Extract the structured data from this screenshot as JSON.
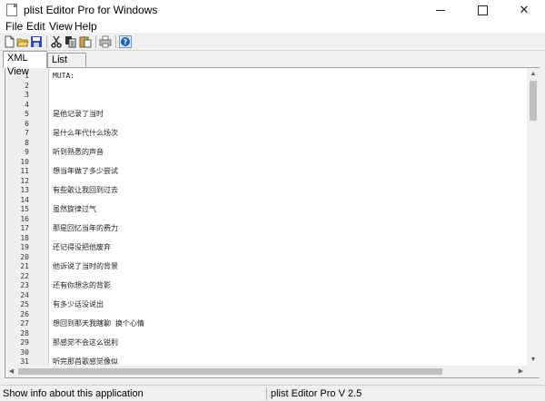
{
  "window": {
    "title": "plist Editor Pro for Windows",
    "minimize_glyph": "",
    "maximize_glyph": "",
    "close_glyph": "✕"
  },
  "menu": [
    "File",
    "Edit",
    "View",
    "Help"
  ],
  "toolbar": {
    "icons": [
      "new-file-icon",
      "open-folder-icon",
      "save-icon",
      "cut-icon",
      "copy-icon",
      "paste-icon",
      "print-icon",
      "help-icon"
    ]
  },
  "tabs": [
    {
      "label": "XML View",
      "active": true
    },
    {
      "label": "List View",
      "active": false
    }
  ],
  "editor": {
    "lines": [
      {
        "num": "1",
        "text": "MUTA:"
      },
      {
        "num": "2",
        "text": ""
      },
      {
        "num": "3",
        "text": ""
      },
      {
        "num": "4",
        "text": ""
      },
      {
        "num": "5",
        "text": "是他记录了当时"
      },
      {
        "num": "6",
        "text": ""
      },
      {
        "num": "7",
        "text": "是什么年代什么场次"
      },
      {
        "num": "8",
        "text": ""
      },
      {
        "num": "9",
        "text": "听到熟悉的声音"
      },
      {
        "num": "10",
        "text": ""
      },
      {
        "num": "11",
        "text": "想当年做了多少尝试"
      },
      {
        "num": "12",
        "text": ""
      },
      {
        "num": "13",
        "text": "有些歌让我回到过去"
      },
      {
        "num": "14",
        "text": ""
      },
      {
        "num": "15",
        "text": "虽然旋律过气"
      },
      {
        "num": "16",
        "text": ""
      },
      {
        "num": "17",
        "text": "那是回忆当年的费力"
      },
      {
        "num": "18",
        "text": ""
      },
      {
        "num": "19",
        "text": "还记得没把他废弃"
      },
      {
        "num": "20",
        "text": ""
      },
      {
        "num": "21",
        "text": "他诉说了当时的背景"
      },
      {
        "num": "22",
        "text": ""
      },
      {
        "num": "23",
        "text": "还有你想念的背影"
      },
      {
        "num": "24",
        "text": ""
      },
      {
        "num": "25",
        "text": "有多少话没说出"
      },
      {
        "num": "26",
        "text": ""
      },
      {
        "num": "27",
        "text": "想回到那天我瞎聊 换个心情"
      },
      {
        "num": "28",
        "text": ""
      },
      {
        "num": "29",
        "text": "那感觉不会这么锐利"
      },
      {
        "num": "30",
        "text": ""
      },
      {
        "num": "31",
        "text": "听完那首歌感觉像似"
      }
    ],
    "scroll_position": 0.0
  },
  "status": {
    "left": "Show info about this application",
    "right": "plist Editor Pro V 2.5"
  },
  "colors": {
    "background": "#f0f0f0",
    "editor_bg": "#ffffff",
    "gutter_bg": "#efefef",
    "help_icon_blue": "#1e5fc4",
    "save_icon_blue": "#2b4fa8"
  }
}
